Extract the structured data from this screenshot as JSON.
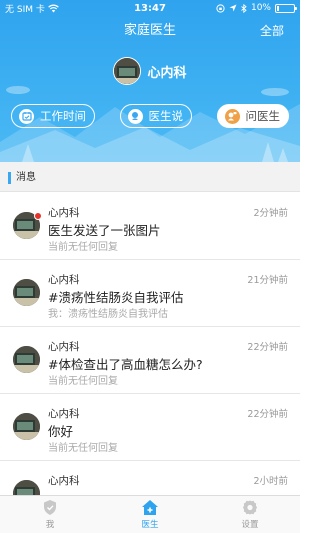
{
  "status_bar": {
    "carrier": "无 SIM 卡",
    "time": "13:47",
    "battery": "10%",
    "battery_level": 0.1
  },
  "nav": {
    "title": "家庭医生",
    "right_label": "全部"
  },
  "doctor": {
    "name": "心内科"
  },
  "pills": [
    {
      "label": "工作时间",
      "icon": "calendar-icon"
    },
    {
      "label": "医生说",
      "icon": "doctor-says-icon"
    },
    {
      "label": "问医生",
      "icon": "ask-doctor-icon"
    }
  ],
  "section": {
    "title": "消息"
  },
  "messages": [
    {
      "name": "心内科",
      "time": "2分钟前",
      "text": "医生发送了一张图片",
      "reply": "当前无任何回复",
      "unread": true
    },
    {
      "name": "心内科",
      "time": "21分钟前",
      "text": "#溃疡性结肠炎自我评估",
      "reply": "我：溃疡性结肠炎自我评估",
      "unread": false
    },
    {
      "name": "心内科",
      "time": "22分钟前",
      "text": "#体检查出了高血糖怎么办?",
      "reply": "当前无任何回复",
      "unread": false
    },
    {
      "name": "心内科",
      "time": "22分钟前",
      "text": "你好",
      "reply": "当前无任何回复",
      "unread": false
    },
    {
      "name": "心内科",
      "time": "2小时前",
      "text": "",
      "reply": "",
      "unread": false
    }
  ],
  "tabs": [
    {
      "label": "我",
      "icon": "shield-icon"
    },
    {
      "label": "医生",
      "icon": "doctor-house-icon"
    },
    {
      "label": "设置",
      "icon": "gear-icon"
    }
  ],
  "colors": {
    "primary": "#2fa3ee",
    "accent_orange": "#f0a046",
    "unread_dot": "#e6332a"
  }
}
